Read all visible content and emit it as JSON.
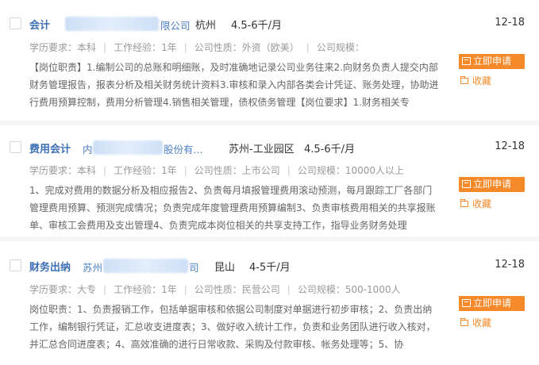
{
  "jobs": [
    {
      "title": "会计",
      "company": "限公司",
      "location": "杭州",
      "salary": "4.5-6千/月",
      "date": "12-18",
      "education": "学历要求：本科",
      "experience": "工作经验：1年",
      "nature": "公司性质：外资（欧美）",
      "scale": "公司规模：",
      "description": "【岗位职责】1.编制公司的总账和明细账，及时准确地记录公司业务往来2.向财务负责人提交内部财务管理报告，报表分析及相关财务统计资料3.审核和录入内部各类会计凭证、账务处理，协助进行费用预算控制，费用分析管理4.销售相关管理，债权债务管理【岗位要求】1.财务相关专",
      "apply_label": "立即申请",
      "fav_label": "收藏"
    },
    {
      "title": "费用会计",
      "company": "股份有...",
      "company_prefix": "内",
      "location": "苏州-工业园区",
      "salary": "4.5-6千/月",
      "date": "12-18",
      "education": "学历要求：本科",
      "experience": "工作经验：1年",
      "nature": "公司性质：上市公司",
      "scale": "公司规模：10000人以上",
      "description": "1、完成对费用的数据分析及相应报告2、负责每月填报管理费用滚动预测，每月跟踪工厂各部门管理费用预算、预测完成情况；负责完成年度管理费用预算编制3、负责审核费用相关的共享报账单、审核工会费用及支出管理4、负责完成本岗位相关的共享支持工作，指导业务财务处理",
      "apply_label": "立即申请",
      "fav_label": "收藏"
    },
    {
      "title": "财务出纳",
      "company_prefix": "苏州",
      "company": "司",
      "location": "昆山",
      "salary": "4-5千/月",
      "date": "12-18",
      "education": "学历要求：大专",
      "experience": "工作经验：1年",
      "nature": "公司性质：民营公司",
      "scale": "公司规模：500-1000人",
      "description": "岗位职责：1、负责报销工作，包括单据审核和依据公司制度对单据进行初步审核；2、负责出纳工作，编制银行凭证，汇总收支进度表；3、做好收入统计工作，负责和业务团队进行收入核对，并汇总合同进度表；4、高效准确的进行日常收款、采购及付款审核、帐务处理等；5、协",
      "apply_label": "立即申请",
      "fav_label": "收藏"
    }
  ]
}
